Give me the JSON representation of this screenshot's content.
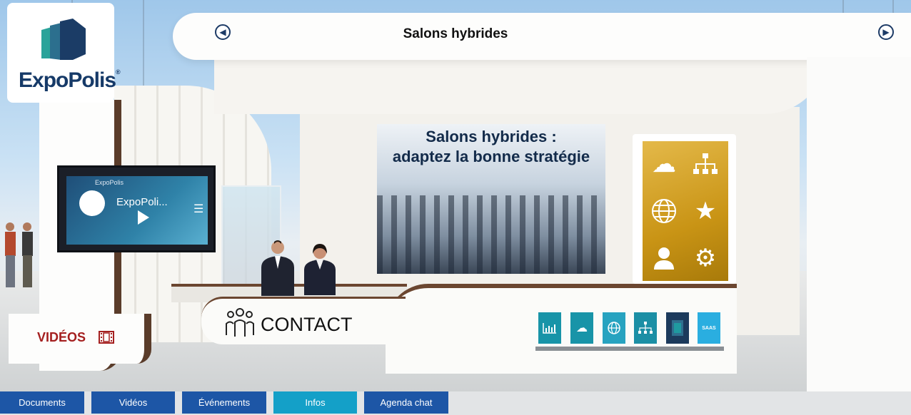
{
  "header": {
    "title": "Salons hybrides",
    "prev_icon": "arrow-left-circle-icon",
    "next_icon": "arrow-right-circle-icon"
  },
  "brand": {
    "name": "ExpoPolis",
    "reg": "®",
    "color": "#163a68"
  },
  "video_panel": {
    "channel": "ExpoPolis",
    "title": "ExpoPoli...",
    "play_icon": "play-icon",
    "menu_icon": "playlist-icon"
  },
  "screen": {
    "line1": "Salons hybrides :",
    "line2": "adaptez la bonne stratégie"
  },
  "side_icons": [
    "cloud-icon",
    "network-icon",
    "globe-icon",
    "star-icon",
    "user-icon",
    "gear-icon"
  ],
  "contact": {
    "label": "CONTACT",
    "icon": "team-icon"
  },
  "videos": {
    "label": "VIDÉOS",
    "icon": "film-icon",
    "color": "#a41f1f"
  },
  "tiles": [
    {
      "icon": "bar-chart-icon",
      "color": "#1894a8"
    },
    {
      "icon": "cloud-icon",
      "color": "#1894a8"
    },
    {
      "icon": "globe-icon",
      "color": "#27a3c0"
    },
    {
      "icon": "network-icon",
      "color": "#1b8fa5"
    },
    {
      "icon": "image-icon",
      "color": "#1c3a5c"
    },
    {
      "icon": "saas-icon",
      "label": "SAAS",
      "color": "#2aaee0"
    }
  ],
  "menu": [
    {
      "label": "Documents",
      "color": "#1d56a6"
    },
    {
      "label": "Vidéos",
      "color": "#1d56a6"
    },
    {
      "label": "Événements",
      "color": "#1d56a6"
    },
    {
      "label": "Infos",
      "color": "#14a0c8"
    },
    {
      "label": "Agenda chat",
      "color": "#1d56a6"
    }
  ]
}
